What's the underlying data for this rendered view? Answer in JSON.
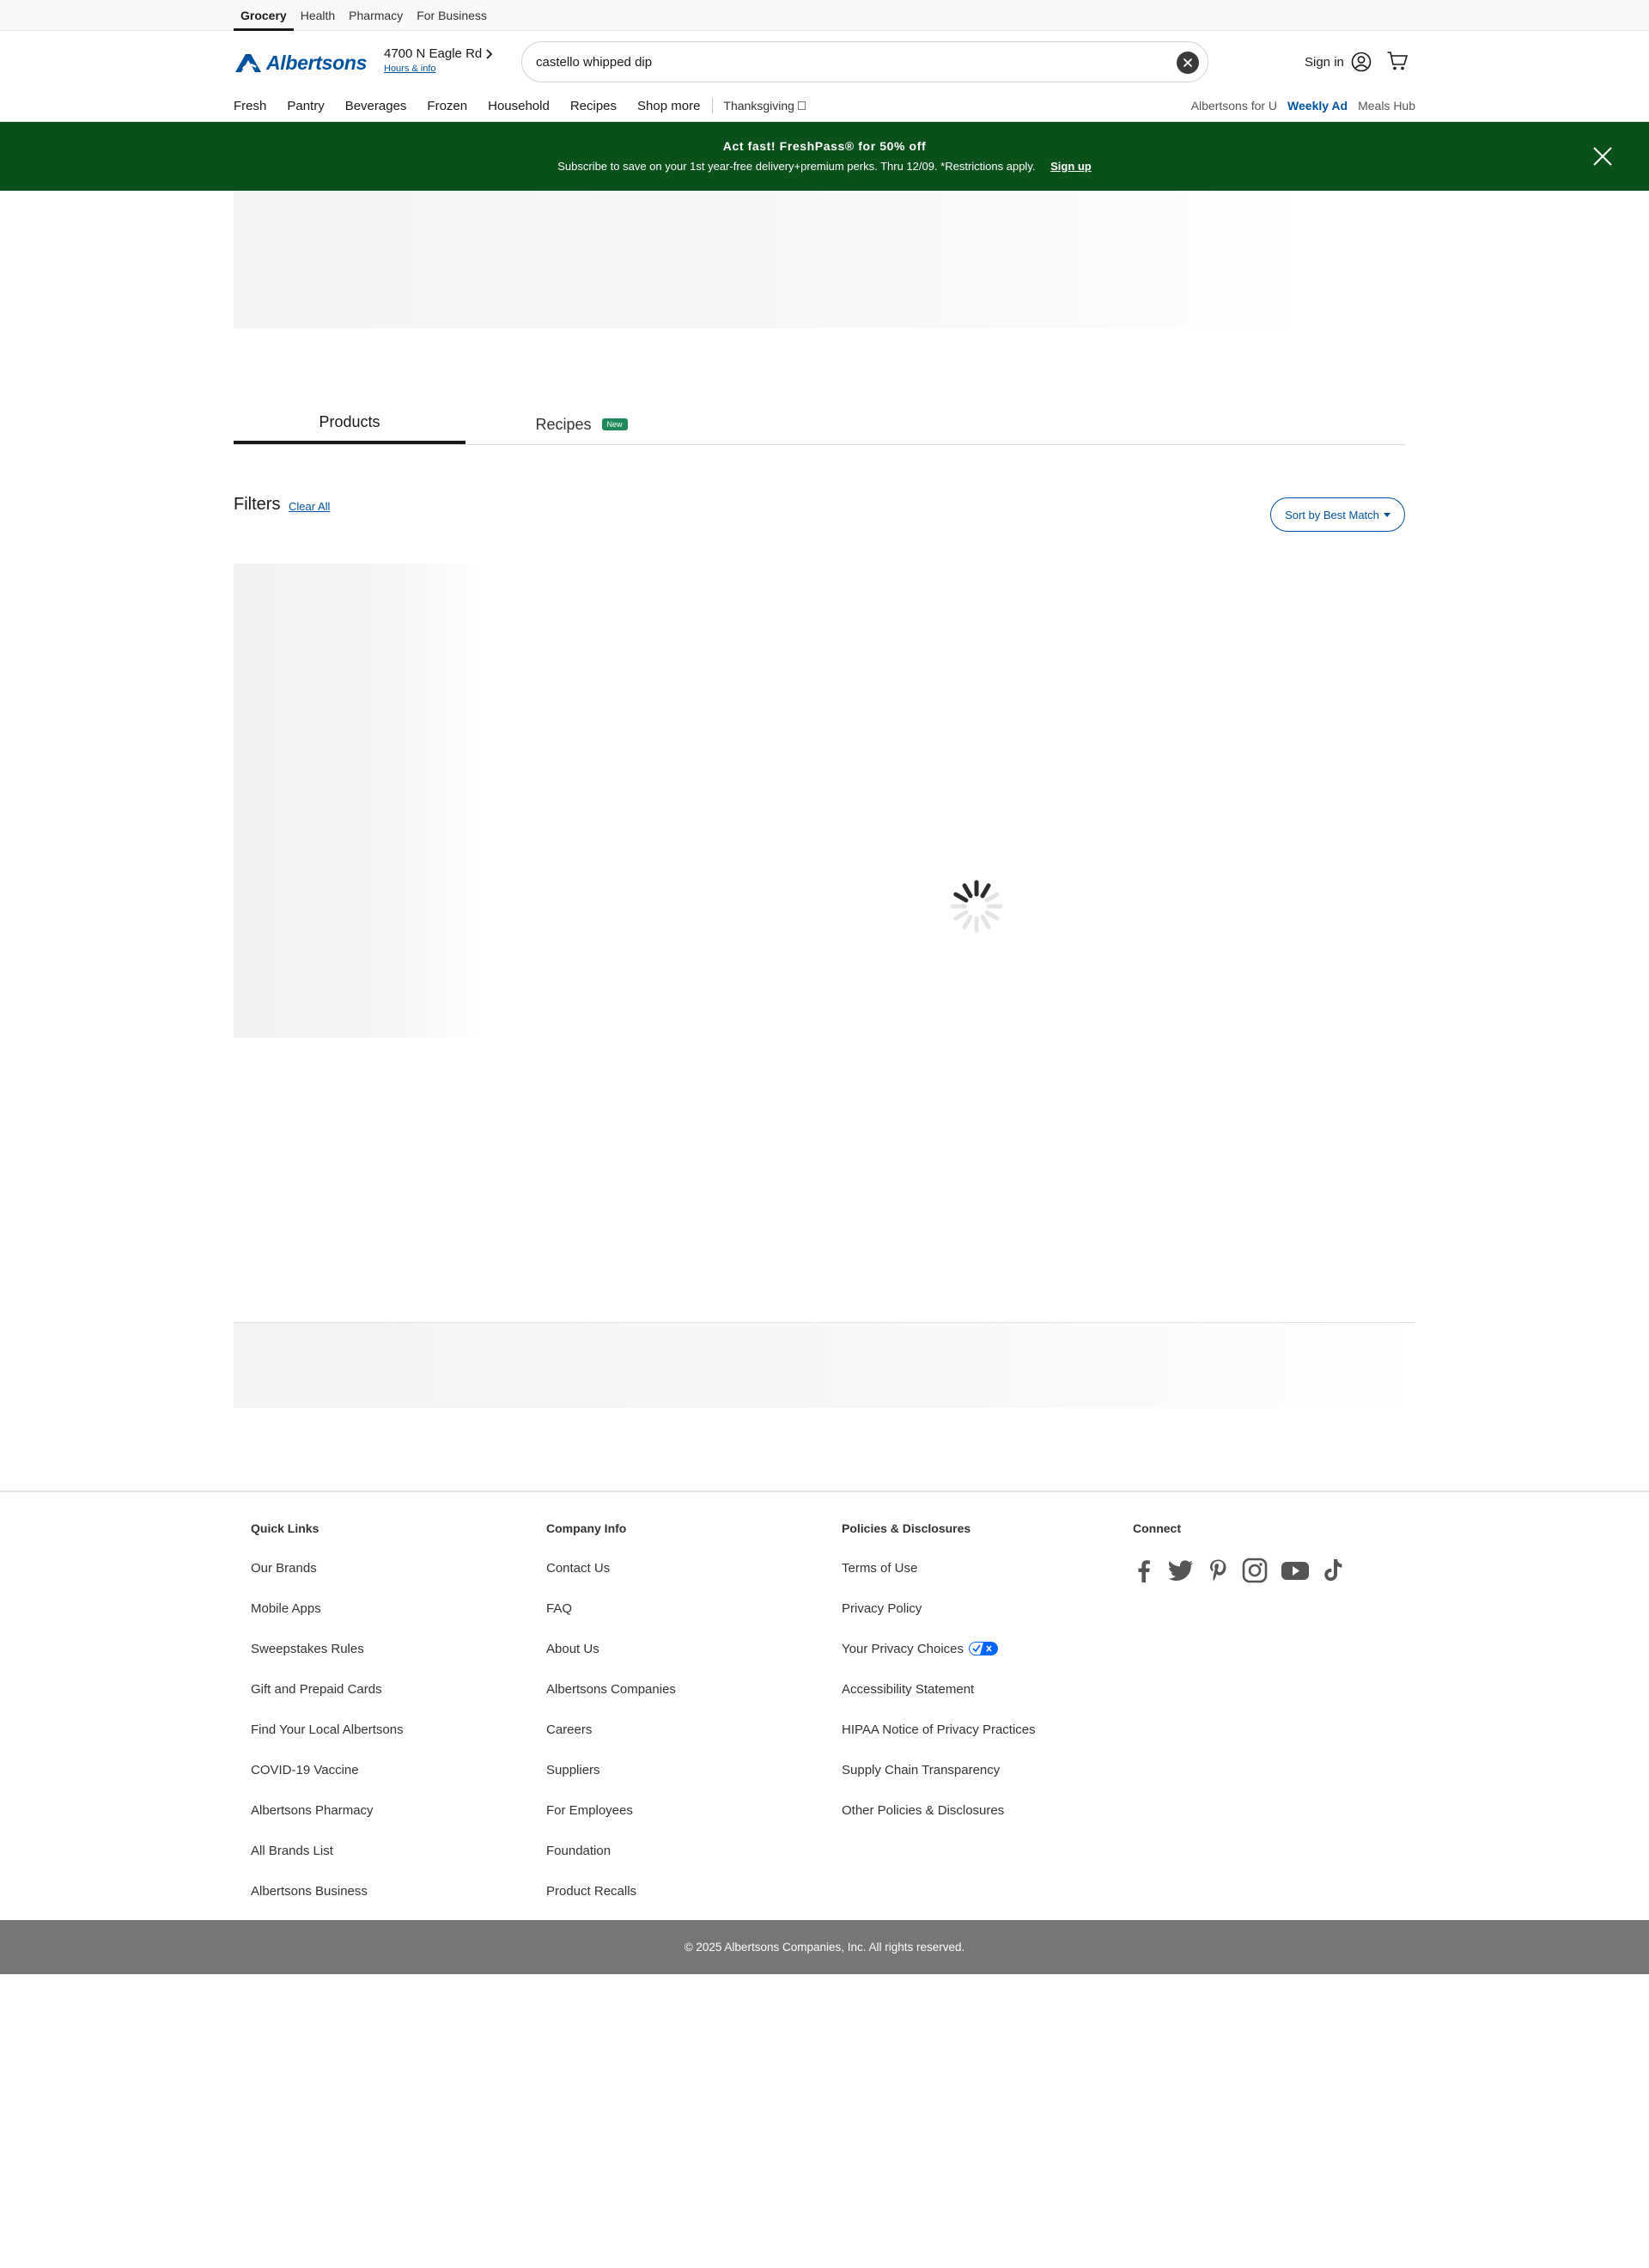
{
  "util_bar": {
    "links": [
      "Grocery",
      "Health",
      "Pharmacy",
      "For Business"
    ]
  },
  "header": {
    "logo_text": "Albertsons",
    "store_name": "4700 N Eagle Rd",
    "store_hours": "Hours & info",
    "search_value": "castello whipped dip",
    "sign_in": "Sign in"
  },
  "nav": {
    "items": [
      "Fresh",
      "Pantry",
      "Beverages",
      "Frozen",
      "Household",
      "Recipes",
      "Shop more"
    ],
    "thanksgiving": "Thanksgiving",
    "right": [
      "Albertsons for U",
      "Weekly Ad",
      "Meals Hub"
    ]
  },
  "banner": {
    "title": "Act fast! FreshPass® for 50% off",
    "subtitle": "Subscribe to save on your 1st year-free delivery+premium perks. Thru 12/09. *Restrictions apply.",
    "cta": "Sign up",
    "bg_color": "#0a501b"
  },
  "tabs": {
    "products": "Products",
    "recipes": "Recipes",
    "recipes_badge": "New"
  },
  "filters": {
    "label": "Filters",
    "clear_all": "Clear All",
    "sort": "Sort by Best Match"
  },
  "footer": {
    "quick_links": {
      "heading": "Quick Links",
      "items": [
        "Our Brands",
        "Mobile Apps",
        "Sweepstakes Rules",
        "Gift and Prepaid Cards",
        "Find Your Local Albertsons",
        "COVID-19 Vaccine",
        "Albertsons Pharmacy",
        "All Brands List",
        "Albertsons Business"
      ]
    },
    "company_info": {
      "heading": "Company Info",
      "items": [
        "Contact Us",
        "FAQ",
        "About Us",
        "Albertsons Companies",
        "Careers",
        "Suppliers",
        "For Employees",
        "Foundation",
        "Product Recalls"
      ]
    },
    "policies": {
      "heading": "Policies & Disclosures",
      "items": [
        "Terms of Use",
        "Privacy Policy",
        "Your Privacy Choices",
        "Accessibility Statement",
        "HIPAA Notice of Privacy Practices",
        "Supply Chain Transparency",
        "Other Policies & Disclosures"
      ]
    },
    "connect": {
      "heading": "Connect",
      "icons": [
        "facebook-icon",
        "twitter-icon",
        "pinterest-icon",
        "instagram-icon",
        "youtube-icon",
        "tiktok-icon"
      ]
    },
    "copyright": "© 2025 Albertsons Companies, Inc.  All rights reserved."
  },
  "colors": {
    "brand_blue": "#00529f",
    "banner_green": "#0a501b",
    "new_badge": "#1e8a5a",
    "copyright_bg": "#767676"
  }
}
